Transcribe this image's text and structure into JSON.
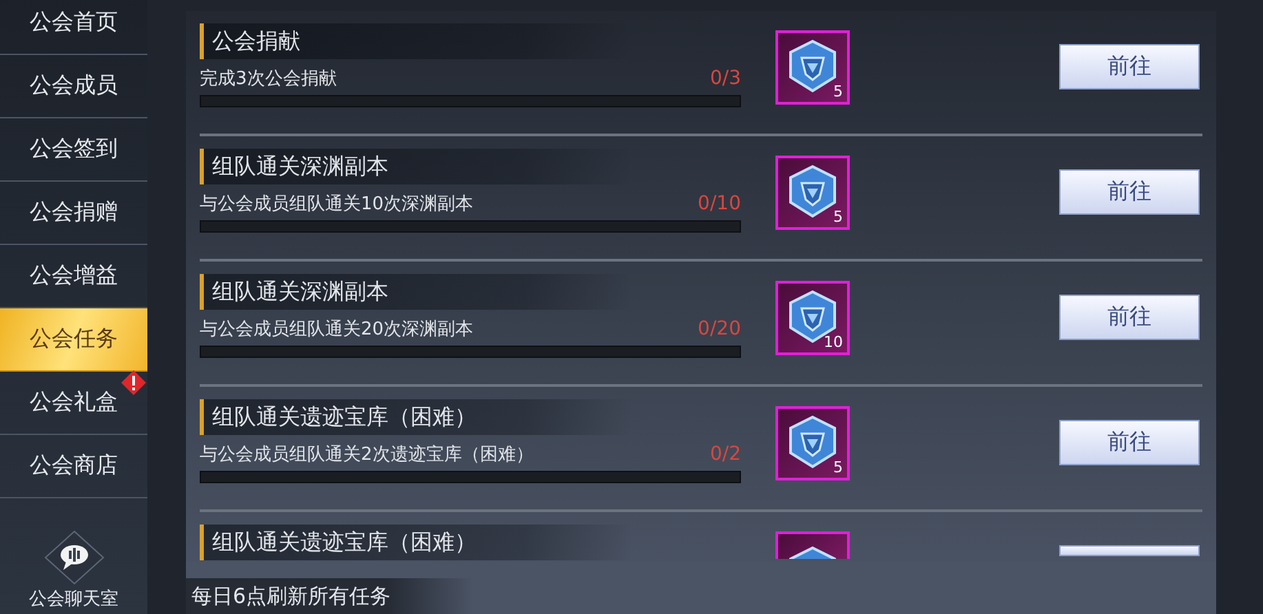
{
  "sidebar": {
    "items": [
      {
        "label": "公会首页",
        "selected": false,
        "alert": false
      },
      {
        "label": "公会成员",
        "selected": false,
        "alert": false
      },
      {
        "label": "公会签到",
        "selected": false,
        "alert": false
      },
      {
        "label": "公会捐赠",
        "selected": false,
        "alert": false
      },
      {
        "label": "公会增益",
        "selected": false,
        "alert": false
      },
      {
        "label": "公会任务",
        "selected": true,
        "alert": false
      },
      {
        "label": "公会礼盒",
        "selected": false,
        "alert": true
      },
      {
        "label": "公会商店",
        "selected": false,
        "alert": false
      }
    ],
    "chat": {
      "label": "公会聊天室"
    }
  },
  "tasks": [
    {
      "title": "公会捐献",
      "description": "完成3次公会捐献",
      "progress": "0/3",
      "level": 0,
      "reward_count": "5",
      "button": "前往"
    },
    {
      "title": "组队通关深渊副本",
      "description": "与公会成员组队通关10次深渊副本",
      "progress": "0/10",
      "level": 0,
      "reward_count": "5",
      "button": "前往"
    },
    {
      "title": "组队通关深渊副本",
      "description": "与公会成员组队通关20次深渊副本",
      "progress": "0/20",
      "level": 0,
      "reward_count": "10",
      "button": "前往"
    },
    {
      "title": "组队通关遗迹宝库（困难）",
      "description": "与公会成员组队通关2次遗迹宝库（困难）",
      "progress": "0/2",
      "level": 0,
      "reward_count": "5",
      "button": "前往"
    },
    {
      "title": "组队通关遗迹宝库（困难）"
    }
  ],
  "footer": {
    "note": "每日6点刷新所有任务"
  }
}
